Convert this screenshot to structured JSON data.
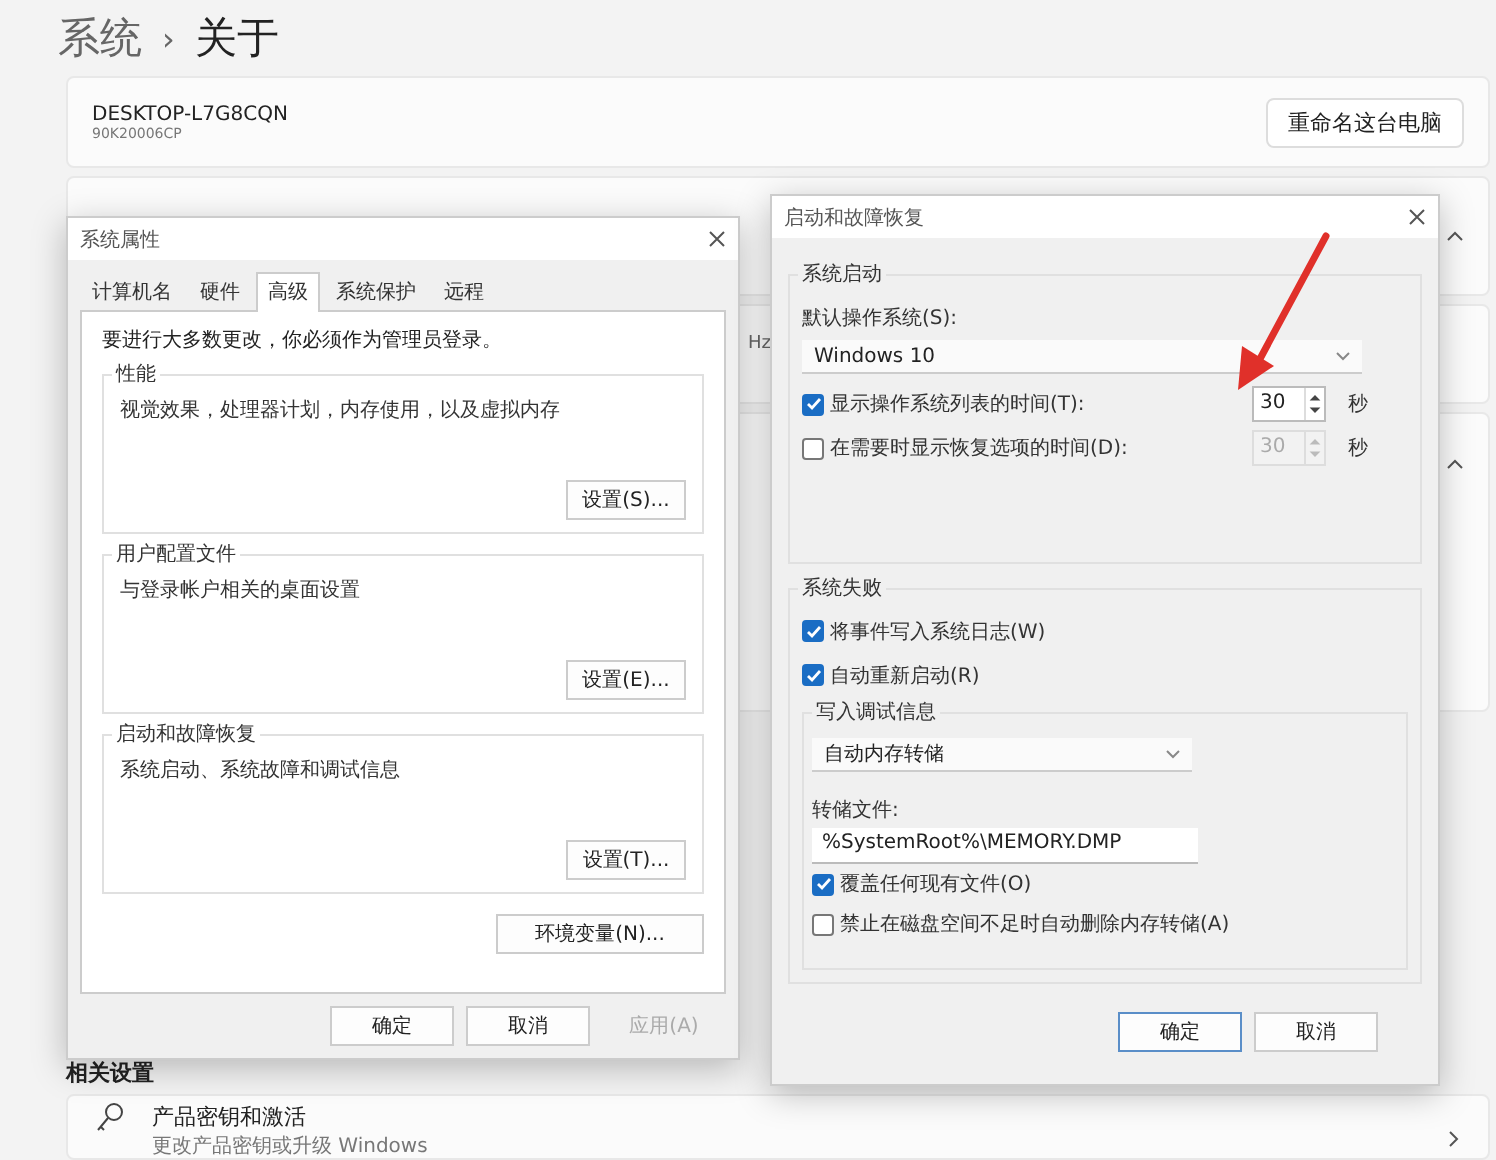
{
  "breadcrumb": {
    "parent": "系统",
    "separator": "›",
    "current": "关于"
  },
  "device": {
    "name": "DESKTOP-L7G8CQN",
    "model": "90K20006CP",
    "rename_button": "重命名这台电脑"
  },
  "background_fragment": "Hz",
  "related": {
    "heading": "相关设置",
    "items": [
      {
        "title": "产品密钥和激活",
        "subtitle": "更改产品密钥或升级 Windows"
      }
    ]
  },
  "system_properties": {
    "title": "系统属性",
    "tabs": [
      {
        "label": "计算机名",
        "selected": false
      },
      {
        "label": "硬件",
        "selected": false
      },
      {
        "label": "高级",
        "selected": true
      },
      {
        "label": "系统保护",
        "selected": false
      },
      {
        "label": "远程",
        "selected": false
      }
    ],
    "notice": "要进行大多数更改，你必须作为管理员登录。",
    "groups": [
      {
        "title": "性能",
        "description": "视觉效果，处理器计划，内存使用，以及虚拟内存",
        "button": "设置(S)..."
      },
      {
        "title": "用户配置文件",
        "description": "与登录帐户相关的桌面设置",
        "button": "设置(E)..."
      },
      {
        "title": "启动和故障恢复",
        "description": "系统启动、系统故障和调试信息",
        "button": "设置(T)..."
      }
    ],
    "env_button": "环境变量(N)...",
    "buttons": [
      {
        "label": "确定",
        "disabled": false
      },
      {
        "label": "取消",
        "disabled": false
      },
      {
        "label": "应用(A)",
        "disabled": true
      }
    ]
  },
  "startup_recovery": {
    "title": "启动和故障恢复",
    "startup": {
      "title": "系统启动",
      "default_os_label": "默认操作系统(S):",
      "default_os": "Windows 10",
      "options": [
        {
          "label": "显示操作系统列表的时间(T):",
          "checked": true,
          "value": "30",
          "unit": "秒",
          "disabled": false
        },
        {
          "label": "在需要时显示恢复选项的时间(D):",
          "checked": false,
          "value": "30",
          "unit": "秒",
          "disabled": true
        }
      ]
    },
    "failure": {
      "title": "系统失败",
      "options": [
        {
          "label": "将事件写入系统日志(W)",
          "checked": true
        },
        {
          "label": "自动重新启动(R)",
          "checked": true
        }
      ],
      "debug": {
        "title": "写入调试信息",
        "type": "自动内存转储",
        "dump_label": "转储文件:",
        "dump_file": "%SystemRoot%\\MEMORY.DMP",
        "options": [
          {
            "label": "覆盖任何现有文件(O)",
            "checked": true
          },
          {
            "label": "禁止在磁盘空间不足时自动删除内存转储(A)",
            "checked": false
          }
        ]
      }
    },
    "buttons": [
      {
        "label": "确定",
        "focused": true
      },
      {
        "label": "取消",
        "focused": false
      }
    ]
  }
}
